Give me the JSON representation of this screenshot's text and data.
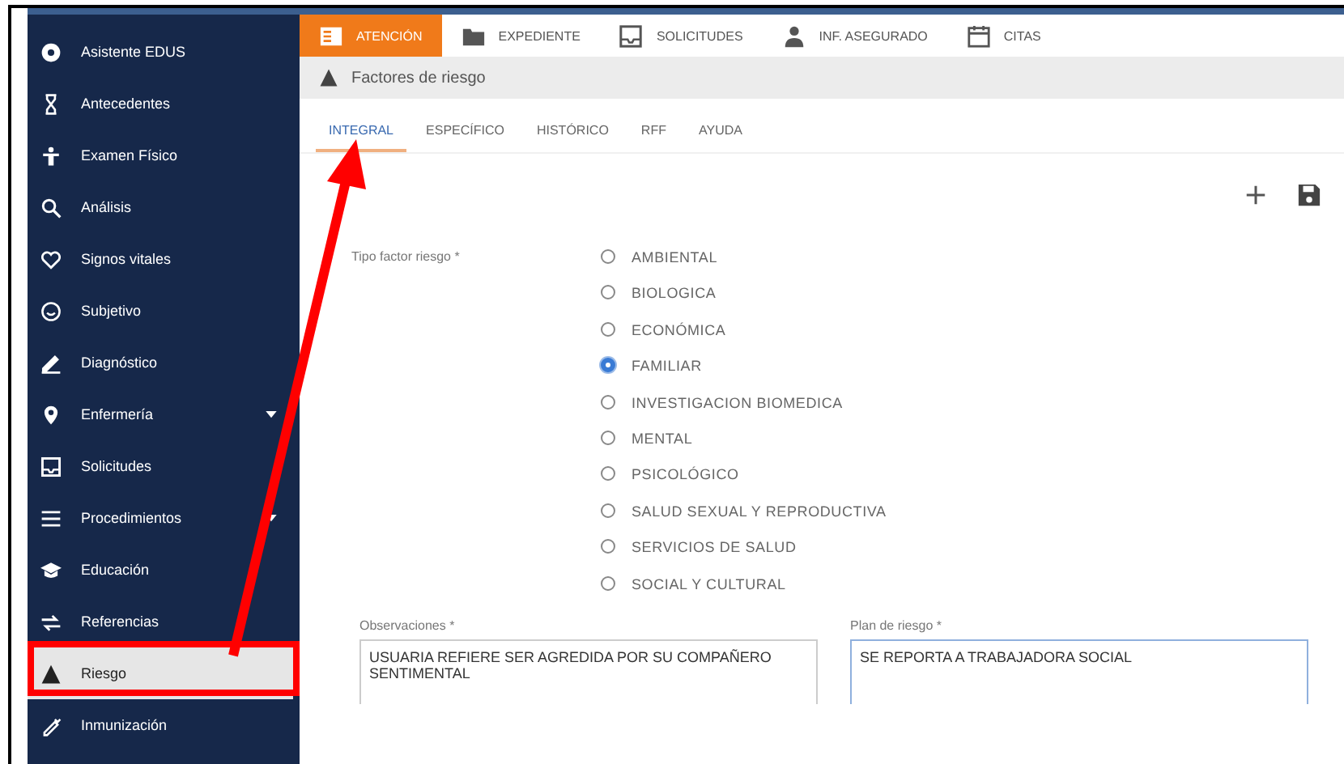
{
  "sidebar": {
    "items": [
      {
        "label": "Asistente EDUS",
        "selected": false,
        "expandable": false
      },
      {
        "label": "Antecedentes",
        "selected": false,
        "expandable": false
      },
      {
        "label": "Examen Físico",
        "selected": false,
        "expandable": false
      },
      {
        "label": "Análisis",
        "selected": false,
        "expandable": false
      },
      {
        "label": "Signos vitales",
        "selected": false,
        "expandable": false
      },
      {
        "label": "Subjetivo",
        "selected": false,
        "expandable": false
      },
      {
        "label": "Diagnóstico",
        "selected": false,
        "expandable": false
      },
      {
        "label": "Enfermería",
        "selected": false,
        "expandable": true
      },
      {
        "label": "Solicitudes",
        "selected": false,
        "expandable": false
      },
      {
        "label": "Procedimientos",
        "selected": false,
        "expandable": true
      },
      {
        "label": "Educación",
        "selected": false,
        "expandable": false
      },
      {
        "label": "Referencias",
        "selected": false,
        "expandable": false
      },
      {
        "label": "Riesgo",
        "selected": true,
        "expandable": false
      },
      {
        "label": "Inmunización",
        "selected": false,
        "expandable": false
      }
    ]
  },
  "top_nav": [
    {
      "label": "ATENCIÓN",
      "selected": true
    },
    {
      "label": "EXPEDIENTE",
      "selected": false
    },
    {
      "label": "SOLICITUDES",
      "selected": false
    },
    {
      "label": "INF. ASEGURADO",
      "selected": false
    },
    {
      "label": "CITAS",
      "selected": false
    }
  ],
  "breadcrumb": {
    "title": "Factores de riesgo"
  },
  "tabs": [
    {
      "label": "INTEGRAL",
      "selected": true
    },
    {
      "label": "ESPECÍFICO",
      "selected": false
    },
    {
      "label": "HISTÓRICO",
      "selected": false
    },
    {
      "label": "RFF",
      "selected": false
    },
    {
      "label": "AYUDA",
      "selected": false
    }
  ],
  "form": {
    "label": "Tipo factor riesgo *",
    "options": [
      {
        "label": "AMBIENTAL",
        "selected": false
      },
      {
        "label": "BIOLOGICA",
        "selected": false
      },
      {
        "label": "ECONÓMICA",
        "selected": false
      },
      {
        "label": "FAMILIAR",
        "selected": true
      },
      {
        "label": "INVESTIGACION BIOMEDICA",
        "selected": false
      },
      {
        "label": "MENTAL",
        "selected": false
      },
      {
        "label": "PSICOLÓGICO",
        "selected": false
      },
      {
        "label": "SALUD SEXUAL Y REPRODUCTIVA",
        "selected": false
      },
      {
        "label": "SERVICIOS DE SALUD",
        "selected": false
      },
      {
        "label": "SOCIAL Y CULTURAL",
        "selected": false
      }
    ]
  },
  "textareas": [
    {
      "label": "Observaciones *",
      "value": "USUARIA REFIERE SER AGREDIDA POR SU COMPAÑERO SENTIMENTAL",
      "focused": false
    },
    {
      "label": "Plan de riesgo *",
      "value": "SE REPORTA A TRABAJADORA SOCIAL",
      "focused": true
    }
  ]
}
